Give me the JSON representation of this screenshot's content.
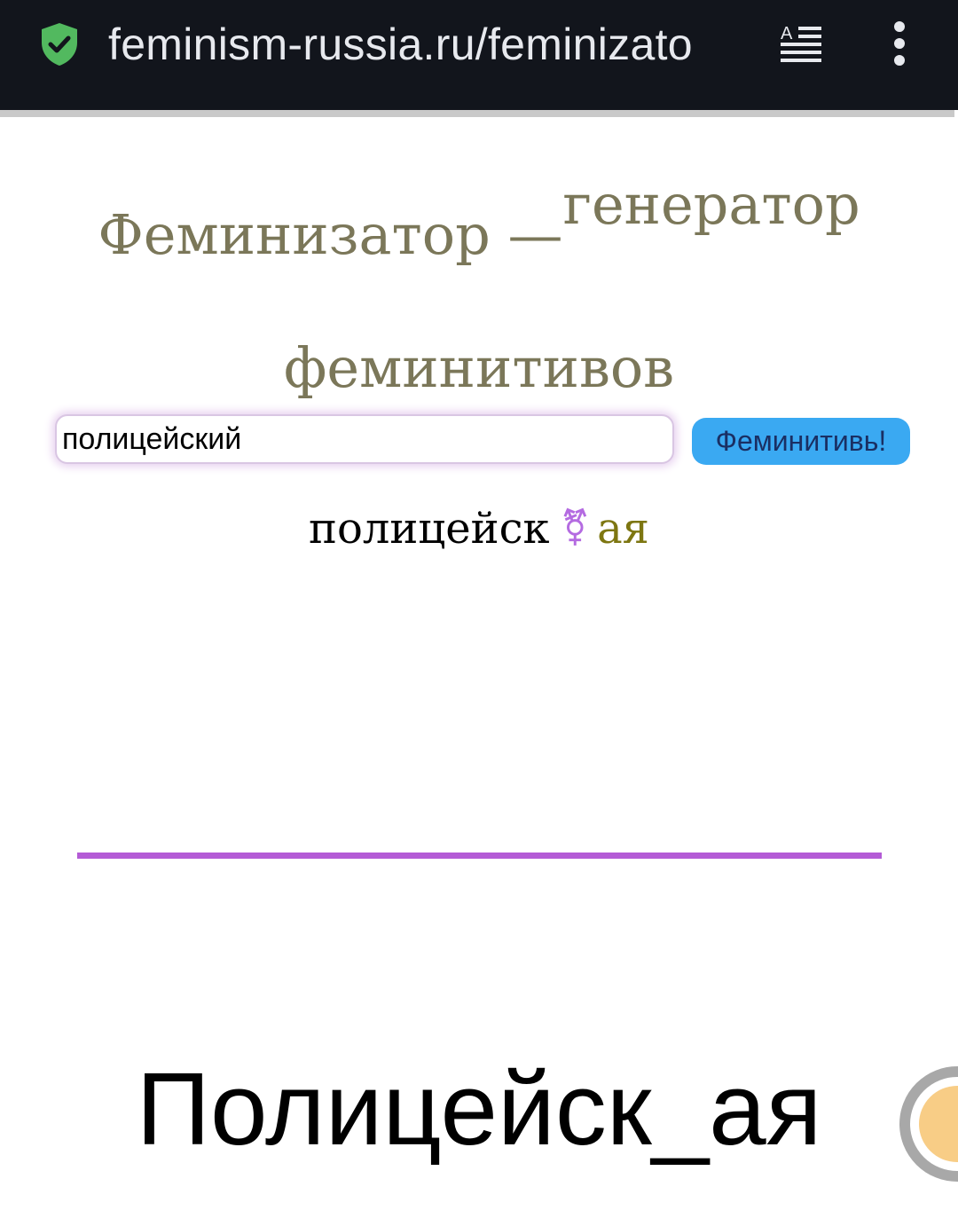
{
  "browser": {
    "url": "feminism-russia.ru/feminizato",
    "icons": {
      "security": "shield-check-icon",
      "reader": "reader-mode-icon",
      "menu": "more-vertical-icon"
    },
    "colors": {
      "bar": "#12151c",
      "shield": "#52b95f"
    }
  },
  "page": {
    "title_main": "Феминизатор —",
    "title_sup": "генератор",
    "title_line2": "феминитивов",
    "input": {
      "value": "полицейский"
    },
    "button_label": "Феминитивь!",
    "result": {
      "stem": "полицейск",
      "symbol": "⚧",
      "suffix": "ая"
    },
    "big_output": "Полицейск_ая",
    "scroll_top_icon": "arrow-up-icon",
    "colors": {
      "title": "#7b7759",
      "button": "#3aa9f2",
      "divider": "#b45bd6",
      "symbol": "#b46be1",
      "suffix": "#7d7611"
    }
  }
}
